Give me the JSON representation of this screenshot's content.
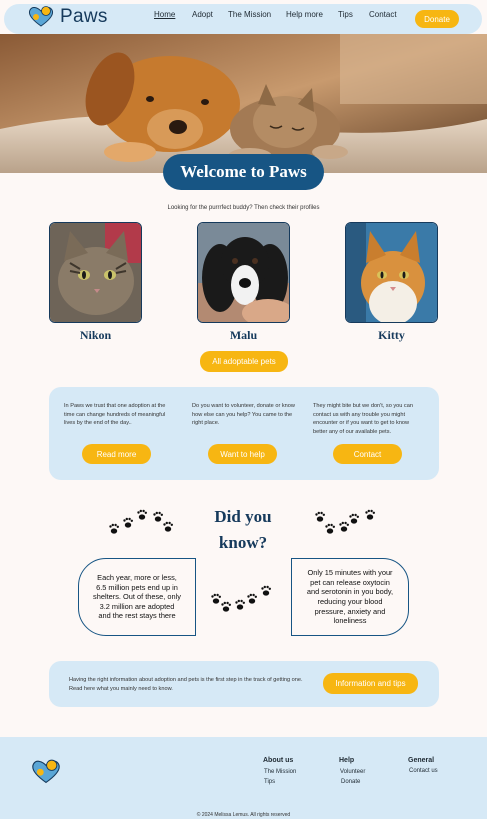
{
  "nav": {
    "brand": "Paws",
    "links": [
      "Home",
      "Adopt",
      "The Mission",
      "Help more",
      "Tips",
      "Contact"
    ],
    "donate": "Donate"
  },
  "hero": {
    "welcome": "Welcome to Paws",
    "tagline": "Looking for the purrrfect buddy? Then check their profiles"
  },
  "pets": [
    {
      "name": "Nikon"
    },
    {
      "name": "Malu"
    },
    {
      "name": "Kitty"
    }
  ],
  "all_pets_button": "All adoptable pets",
  "info": [
    {
      "text": "In Paws we trust that one adoption at the time can change hundreds of meaningful lives by the end of the day..",
      "button": "Read more"
    },
    {
      "text": "Do you want to volunteer, donate or know how else can you help? You came to the right place.",
      "button": "Want to help"
    },
    {
      "text": "They might bite but we don't, so you can contact us with any trouble you might encounter or if you want to get to know better any of our available pets.",
      "button": "Contact"
    }
  ],
  "did_you_know": {
    "title": "Did you know?",
    "facts": [
      "Each year, more or less, 6.5 million pets end up in shelters. Out of these, only 3.2 million are adopted and the rest stays there",
      "Only 15 minutes with your pet can release oxytocin and serotonin in you body, reducing your blood pressure, anxiety and loneliness"
    ]
  },
  "tips": {
    "text": "Having the right information about adoption and pets is the first step in the track of getting one. Read here what you mainly need to know.",
    "button": "Information and tips"
  },
  "footer": {
    "columns": [
      {
        "heading": "About us",
        "links": [
          "The Mission",
          "Tips"
        ]
      },
      {
        "heading": "Help",
        "links": [
          "Volunteer",
          "Donate"
        ]
      },
      {
        "heading": "General",
        "links": [
          "Contact us"
        ]
      }
    ],
    "copyright": "© 2024 Melissa Lemus. All rights reserved"
  },
  "colors": {
    "accent": "#f7b612",
    "brand": "#175584",
    "panel": "#d6e9f6"
  }
}
